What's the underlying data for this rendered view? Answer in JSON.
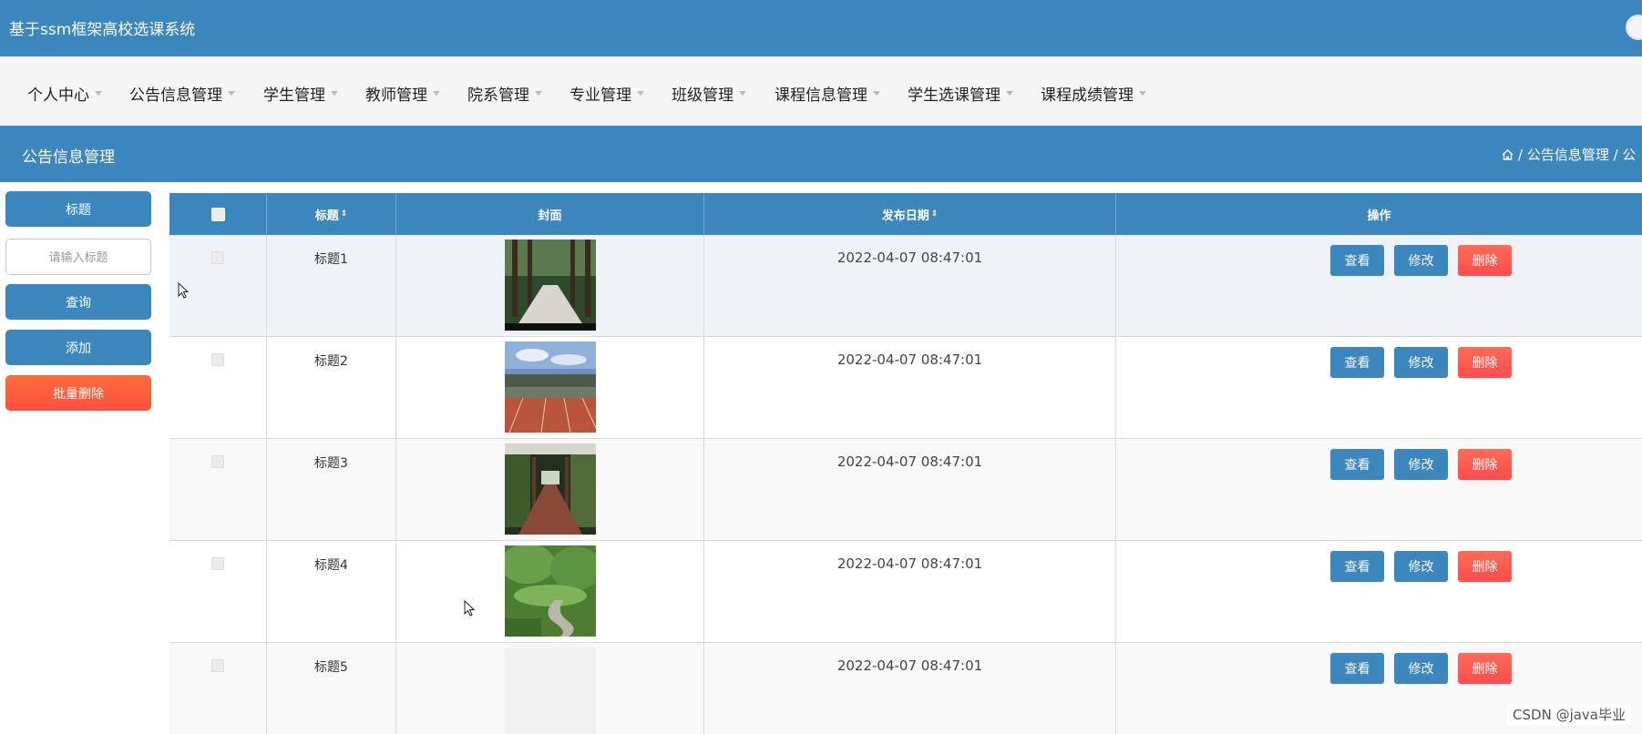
{
  "header": {
    "title": "基于ssm框架高校选课系统"
  },
  "nav": {
    "items": [
      {
        "label": "个人中心"
      },
      {
        "label": "公告信息管理"
      },
      {
        "label": "学生管理"
      },
      {
        "label": "教师管理"
      },
      {
        "label": "院系管理"
      },
      {
        "label": "专业管理"
      },
      {
        "label": "班级管理"
      },
      {
        "label": "课程信息管理"
      },
      {
        "label": "学生选课管理"
      },
      {
        "label": "课程成绩管理"
      }
    ]
  },
  "section": {
    "title": "公告信息管理",
    "breadcrumb": "/ 公告信息管理 / 公"
  },
  "sidebar": {
    "title_label": "标题",
    "search_placeholder": "请输入标题",
    "query_label": "查询",
    "add_label": "添加",
    "batch_delete_label": "批量删除"
  },
  "table": {
    "columns": [
      "",
      "标题",
      "封面",
      "发布日期",
      "操作"
    ],
    "sort_icon": "⇕",
    "rows": [
      {
        "title": "标题1",
        "date": "2022-04-07 08:47:01",
        "cover": "tree-lined-path"
      },
      {
        "title": "标题2",
        "date": "2022-04-07 08:47:01",
        "cover": "running-track"
      },
      {
        "title": "标题3",
        "date": "2022-04-07 08:47:01",
        "cover": "covered-walkway"
      },
      {
        "title": "标题4",
        "date": "2022-04-07 08:47:01",
        "cover": "garden-path"
      },
      {
        "title": "标题5",
        "date": "2022-04-07 08:47:01",
        "cover": "blank"
      }
    ],
    "actions": {
      "view": "查看",
      "edit": "修改",
      "delete": "删除"
    }
  },
  "watermark": "CSDN @java毕业",
  "colors": {
    "primary": "#3c87bd",
    "danger": "#ff4d4f",
    "nav_bg": "#f5f5f5"
  }
}
